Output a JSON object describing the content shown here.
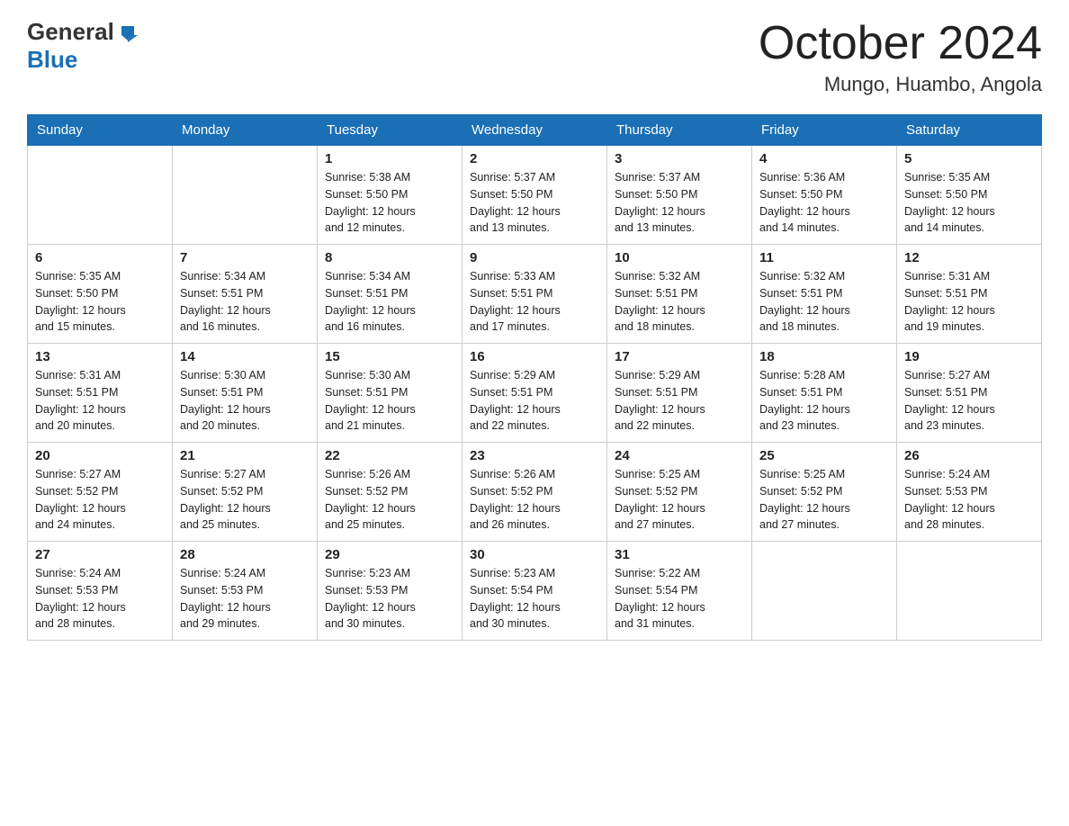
{
  "header": {
    "logo_general": "General",
    "logo_blue": "Blue",
    "month": "October 2024",
    "location": "Mungo, Huambo, Angola"
  },
  "days_of_week": [
    "Sunday",
    "Monday",
    "Tuesday",
    "Wednesday",
    "Thursday",
    "Friday",
    "Saturday"
  ],
  "weeks": [
    [
      {
        "day": "",
        "info": ""
      },
      {
        "day": "",
        "info": ""
      },
      {
        "day": "1",
        "info": "Sunrise: 5:38 AM\nSunset: 5:50 PM\nDaylight: 12 hours\nand 12 minutes."
      },
      {
        "day": "2",
        "info": "Sunrise: 5:37 AM\nSunset: 5:50 PM\nDaylight: 12 hours\nand 13 minutes."
      },
      {
        "day": "3",
        "info": "Sunrise: 5:37 AM\nSunset: 5:50 PM\nDaylight: 12 hours\nand 13 minutes."
      },
      {
        "day": "4",
        "info": "Sunrise: 5:36 AM\nSunset: 5:50 PM\nDaylight: 12 hours\nand 14 minutes."
      },
      {
        "day": "5",
        "info": "Sunrise: 5:35 AM\nSunset: 5:50 PM\nDaylight: 12 hours\nand 14 minutes."
      }
    ],
    [
      {
        "day": "6",
        "info": "Sunrise: 5:35 AM\nSunset: 5:50 PM\nDaylight: 12 hours\nand 15 minutes."
      },
      {
        "day": "7",
        "info": "Sunrise: 5:34 AM\nSunset: 5:51 PM\nDaylight: 12 hours\nand 16 minutes."
      },
      {
        "day": "8",
        "info": "Sunrise: 5:34 AM\nSunset: 5:51 PM\nDaylight: 12 hours\nand 16 minutes."
      },
      {
        "day": "9",
        "info": "Sunrise: 5:33 AM\nSunset: 5:51 PM\nDaylight: 12 hours\nand 17 minutes."
      },
      {
        "day": "10",
        "info": "Sunrise: 5:32 AM\nSunset: 5:51 PM\nDaylight: 12 hours\nand 18 minutes."
      },
      {
        "day": "11",
        "info": "Sunrise: 5:32 AM\nSunset: 5:51 PM\nDaylight: 12 hours\nand 18 minutes."
      },
      {
        "day": "12",
        "info": "Sunrise: 5:31 AM\nSunset: 5:51 PM\nDaylight: 12 hours\nand 19 minutes."
      }
    ],
    [
      {
        "day": "13",
        "info": "Sunrise: 5:31 AM\nSunset: 5:51 PM\nDaylight: 12 hours\nand 20 minutes."
      },
      {
        "day": "14",
        "info": "Sunrise: 5:30 AM\nSunset: 5:51 PM\nDaylight: 12 hours\nand 20 minutes."
      },
      {
        "day": "15",
        "info": "Sunrise: 5:30 AM\nSunset: 5:51 PM\nDaylight: 12 hours\nand 21 minutes."
      },
      {
        "day": "16",
        "info": "Sunrise: 5:29 AM\nSunset: 5:51 PM\nDaylight: 12 hours\nand 22 minutes."
      },
      {
        "day": "17",
        "info": "Sunrise: 5:29 AM\nSunset: 5:51 PM\nDaylight: 12 hours\nand 22 minutes."
      },
      {
        "day": "18",
        "info": "Sunrise: 5:28 AM\nSunset: 5:51 PM\nDaylight: 12 hours\nand 23 minutes."
      },
      {
        "day": "19",
        "info": "Sunrise: 5:27 AM\nSunset: 5:51 PM\nDaylight: 12 hours\nand 23 minutes."
      }
    ],
    [
      {
        "day": "20",
        "info": "Sunrise: 5:27 AM\nSunset: 5:52 PM\nDaylight: 12 hours\nand 24 minutes."
      },
      {
        "day": "21",
        "info": "Sunrise: 5:27 AM\nSunset: 5:52 PM\nDaylight: 12 hours\nand 25 minutes."
      },
      {
        "day": "22",
        "info": "Sunrise: 5:26 AM\nSunset: 5:52 PM\nDaylight: 12 hours\nand 25 minutes."
      },
      {
        "day": "23",
        "info": "Sunrise: 5:26 AM\nSunset: 5:52 PM\nDaylight: 12 hours\nand 26 minutes."
      },
      {
        "day": "24",
        "info": "Sunrise: 5:25 AM\nSunset: 5:52 PM\nDaylight: 12 hours\nand 27 minutes."
      },
      {
        "day": "25",
        "info": "Sunrise: 5:25 AM\nSunset: 5:52 PM\nDaylight: 12 hours\nand 27 minutes."
      },
      {
        "day": "26",
        "info": "Sunrise: 5:24 AM\nSunset: 5:53 PM\nDaylight: 12 hours\nand 28 minutes."
      }
    ],
    [
      {
        "day": "27",
        "info": "Sunrise: 5:24 AM\nSunset: 5:53 PM\nDaylight: 12 hours\nand 28 minutes."
      },
      {
        "day": "28",
        "info": "Sunrise: 5:24 AM\nSunset: 5:53 PM\nDaylight: 12 hours\nand 29 minutes."
      },
      {
        "day": "29",
        "info": "Sunrise: 5:23 AM\nSunset: 5:53 PM\nDaylight: 12 hours\nand 30 minutes."
      },
      {
        "day": "30",
        "info": "Sunrise: 5:23 AM\nSunset: 5:54 PM\nDaylight: 12 hours\nand 30 minutes."
      },
      {
        "day": "31",
        "info": "Sunrise: 5:22 AM\nSunset: 5:54 PM\nDaylight: 12 hours\nand 31 minutes."
      },
      {
        "day": "",
        "info": ""
      },
      {
        "day": "",
        "info": ""
      }
    ]
  ]
}
